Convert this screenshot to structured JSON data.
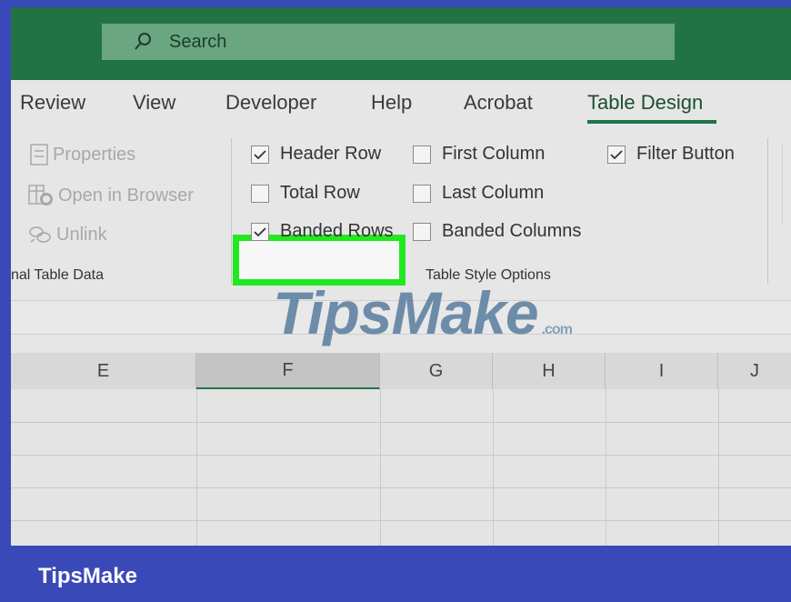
{
  "search": {
    "placeholder": "Search",
    "icon": "search-icon"
  },
  "ribbon_tabs": [
    {
      "label": "Review"
    },
    {
      "label": "View"
    },
    {
      "label": "Developer"
    },
    {
      "label": "Help"
    },
    {
      "label": "Acrobat"
    },
    {
      "label": "Table Design",
      "active": true
    }
  ],
  "external_data": {
    "items": [
      {
        "label": "Properties",
        "icon": "properties-icon",
        "enabled": false
      },
      {
        "label": "Open in Browser",
        "icon": "open-in-browser-icon",
        "enabled": false
      },
      {
        "label": "Unlink",
        "icon": "unlink-icon",
        "enabled": false
      }
    ],
    "group_label": "nal Table Data"
  },
  "table_style_options": {
    "group_label": "Table Style Options",
    "options": [
      {
        "label": "Header Row",
        "checked": true,
        "highlighted": true
      },
      {
        "label": "Total Row",
        "checked": false
      },
      {
        "label": "Banded Rows",
        "checked": true
      },
      {
        "label": "First Column",
        "checked": false
      },
      {
        "label": "Last Column",
        "checked": false
      },
      {
        "label": "Banded Columns",
        "checked": false
      },
      {
        "label": "Filter Button",
        "checked": true
      }
    ]
  },
  "watermark": {
    "text": "TipsMake",
    "suffix": ".com"
  },
  "columns": [
    "E",
    "F",
    "G",
    "H",
    "I",
    "J"
  ],
  "selected_column": "F",
  "footer": {
    "brand": "TipsMake"
  },
  "colors": {
    "excel_green": "#217346",
    "highlight": "#22e820",
    "frame_blue": "#3a49b8"
  }
}
